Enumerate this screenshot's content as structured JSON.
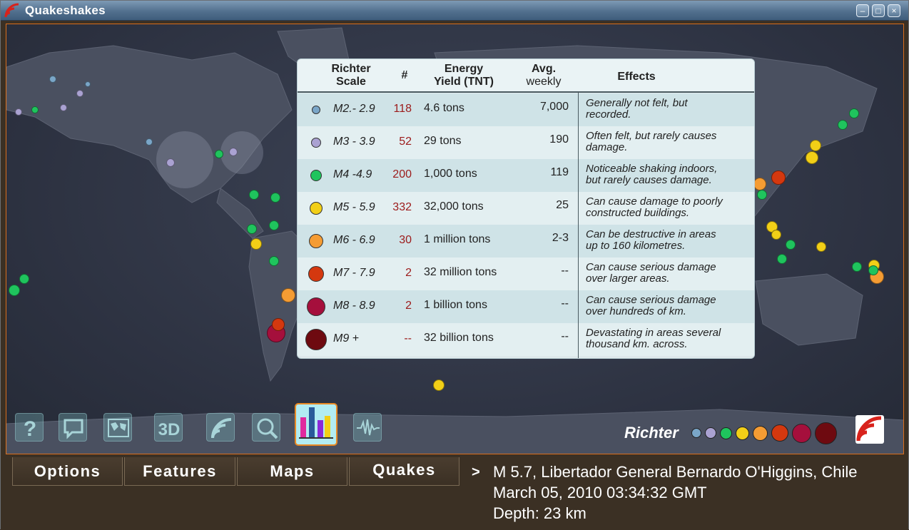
{
  "window": {
    "title": "Quakeshakes",
    "controls": {
      "minimize": "–",
      "maximize": "□",
      "close": "×"
    }
  },
  "legend_table": {
    "headers": {
      "richter_scale": [
        "Richter",
        "Scale"
      ],
      "count": "#",
      "energy": [
        "Energy",
        "Yield (TNT)"
      ],
      "avg": [
        "Avg.",
        "weekly"
      ],
      "effects": "Effects"
    },
    "rows": [
      {
        "color": "#7aa6c8",
        "scale": "M2.- 2.9",
        "count": "118",
        "energy": "4.6 tons",
        "avg": "7,000",
        "effects": [
          "Generally not felt, but",
          "recorded."
        ]
      },
      {
        "color": "#aaa2d2",
        "scale": "M3 - 3.9",
        "count": "52",
        "energy": "29 tons",
        "avg": "190",
        "effects": [
          "Often felt, but rarely causes",
          "damage."
        ]
      },
      {
        "color": "#1fc45d",
        "scale": "M4 -4.9",
        "count": "200",
        "energy": "1,000 tons",
        "avg": "119",
        "effects": [
          "Noticeable shaking indoors,",
          "but rarely causes damage."
        ]
      },
      {
        "color": "#f2cf17",
        "scale": "M5 - 5.9",
        "count": "332",
        "energy": "32,000 tons",
        "avg": "25",
        "effects": [
          "Can cause damage to poorly",
          "constructed buildings."
        ]
      },
      {
        "color": "#f59c33",
        "scale": "M6 - 6.9",
        "count": "30",
        "energy": "1 million tons",
        "avg": "2-3",
        "effects": [
          "Can be destructive in areas",
          "up to 160 kilometres."
        ]
      },
      {
        "color": "#d4380f",
        "scale": "M7 - 7.9",
        "count": "2",
        "energy": "32 million tons",
        "avg": "--",
        "effects": [
          "Can cause serious damage",
          "over larger areas."
        ]
      },
      {
        "color": "#a50f3c",
        "scale": "M8 - 8.9",
        "count": "2",
        "energy": "1 billion tons",
        "avg": "--",
        "effects": [
          "Can cause serious damage",
          "over hundreds of km."
        ]
      },
      {
        "color": "#6e0a10",
        "scale": "M9 +",
        "count": "--",
        "energy": "32 billion tons",
        "avg": "--",
        "effects": [
          "Devastating in areas several",
          "thousand km. across."
        ]
      }
    ]
  },
  "richter_legend": {
    "label": "Richter",
    "colors": [
      "#7aa6c8",
      "#aaa2d2",
      "#1fc45d",
      "#f2cf17",
      "#f59c33",
      "#d4380f",
      "#a50f3c",
      "#6e0a10"
    ]
  },
  "toolbar": {
    "items": [
      "help-icon",
      "comment-icon",
      "world-map-icon",
      "3d-icon",
      "rss-feed-icon",
      "search-icon",
      "bar-chart-icon",
      "seismograph-icon"
    ],
    "active": "bar-chart-icon"
  },
  "menu": {
    "options": "Options",
    "features": "Features",
    "maps": "Maps",
    "quakes": "Quakes"
  },
  "status": {
    "arrow": ">",
    "line1": "M 5.7, Libertador General Bernardo O'Higgins, Chile",
    "line2": "March 05, 2010 03:34:32 GMT",
    "line3": "Depth: 23 km"
  }
}
